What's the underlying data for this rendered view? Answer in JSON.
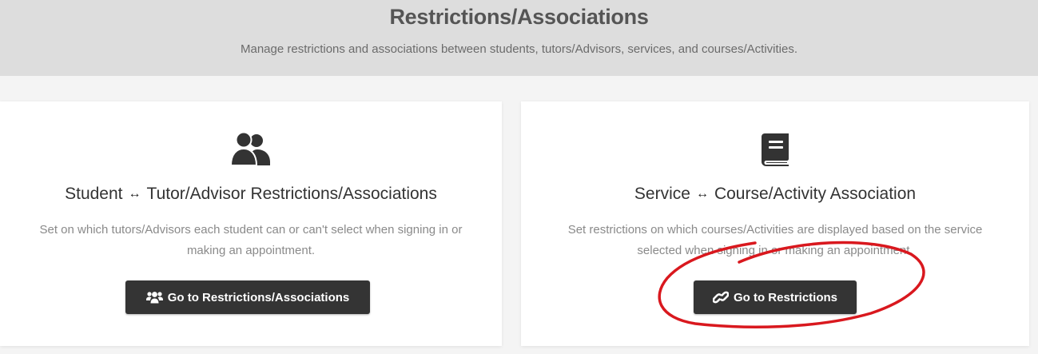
{
  "header": {
    "title": "Restrictions/Associations",
    "subtitle": "Manage restrictions and associations between students, tutors/Advisors, services, and courses/Activities."
  },
  "cards": [
    {
      "icon": "users-icon",
      "title_left": "Student",
      "title_arrow": "↔",
      "title_right": "Tutor/Advisor Restrictions/Associations",
      "description_line1": "Set on which tutors/Advisors each student can or can't select when signing in or",
      "description_line2": "making an appointment.",
      "button_icon": "user-group-icon",
      "button_label": "Go to Restrictions/Associations"
    },
    {
      "icon": "book-icon",
      "title_left": "Service",
      "title_arrow": "↔",
      "title_right": "Course/Activity Association",
      "description_line1": "Set restrictions on which courses/Activities are displayed based on the service",
      "description_line2": "selected when signing in or making an appointment.",
      "button_icon": "link-icon",
      "button_label": "Go to Restrictions"
    }
  ],
  "colors": {
    "header_bg": "#dddddd",
    "button_bg": "#343434",
    "annotation": "#d9181e"
  }
}
